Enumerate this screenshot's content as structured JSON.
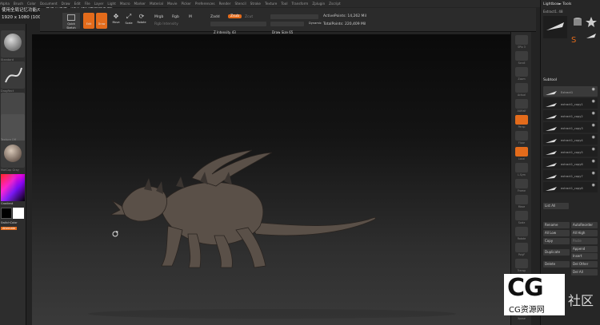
{
  "menu": [
    "Alpha",
    "Brush",
    "Color",
    "Document",
    "Draw",
    "Edit",
    "File",
    "Layer",
    "Light",
    "Macro",
    "Marker",
    "Material",
    "Movie",
    "Picker",
    "Preferences",
    "Render",
    "Stencil",
    "Stroke",
    "Texture",
    "Tool",
    "Transform",
    "Zplugin",
    "Zscript"
  ],
  "title_text": "使用全局记忆功能/0.5倍播放速度（播放控制界面可重置）",
  "resolution": "1920 x 1080 (100%)",
  "toolbar": {
    "quick_sketch": "Quick Sketch",
    "edit": "Edit",
    "draw": "Draw",
    "move": "Move",
    "scale": "Scale",
    "rotate": "Rotate",
    "mrgb": "Mrgb",
    "rgb": "Rgb",
    "m": "M",
    "rgb_intensity": "Rgb Intensity",
    "zadd": "Zadd",
    "zsub": "Zsub",
    "zcut": "Zcut",
    "z_intensity": "Z Intensity 43",
    "focal_shift": "Focal Shift -58",
    "draw_size": "Draw Size 65",
    "dynamic": "Dynamic",
    "active_points": "ActivePoints: 14,262 Mil",
    "total_points": "TotalPoints: 220,409 Mil"
  },
  "left_shelf": {
    "brush_label": "Standard",
    "stroke_label": "DragRect",
    "alpha_label": "Alpha Off",
    "texture_label": "Texture Off",
    "material_label": "MatCap Gray",
    "gradient": "Gradient",
    "switch_color": "SwitchColor",
    "alternate": "Alternate"
  },
  "right_shelf": [
    "SPix 3",
    "Scroll",
    "Zoom",
    "Actual",
    "AAHalf",
    "Persp",
    "Floor",
    "Local",
    "L.Sym",
    "Frame",
    "Move",
    "Scale",
    "Rotate",
    "PolyF",
    "Transp",
    "Ghost",
    "Solo",
    "Xpose"
  ],
  "tray": {
    "lightbox": "Lightbox► Tools",
    "tool_name": "Extract1. 48",
    "thumbs": [
      "Extract1",
      "Cylinder3D",
      "PolyMesh3D",
      "SimpleBrush",
      "Extract1"
    ],
    "subtool_title": "Subtool",
    "subtools": [
      "Extract1",
      "extract1_copy1",
      "extract1_copy2",
      "extract1_copy3",
      "extract1_copy4",
      "extract1_copy5",
      "extract1_copy6",
      "extract1_copy7",
      "extract1_copy8"
    ],
    "list_all": "List All",
    "rename": "Rename",
    "auto_reorder": "AutoReorder",
    "all_low": "All Low",
    "all_high": "All High",
    "copy": "Copy",
    "paste": "Paste",
    "append": "Append",
    "duplicate": "Duplicate",
    "insert": "Insert",
    "delete": "Delete",
    "del_other": "Del Other",
    "del_all": "Del All"
  },
  "watermark": {
    "logo": "CG",
    "sub": "CG资源网",
    "right": "社区"
  },
  "colors": {
    "accent": "#e36b1b",
    "bg": "#232323",
    "panel": "#2b2b2b"
  }
}
